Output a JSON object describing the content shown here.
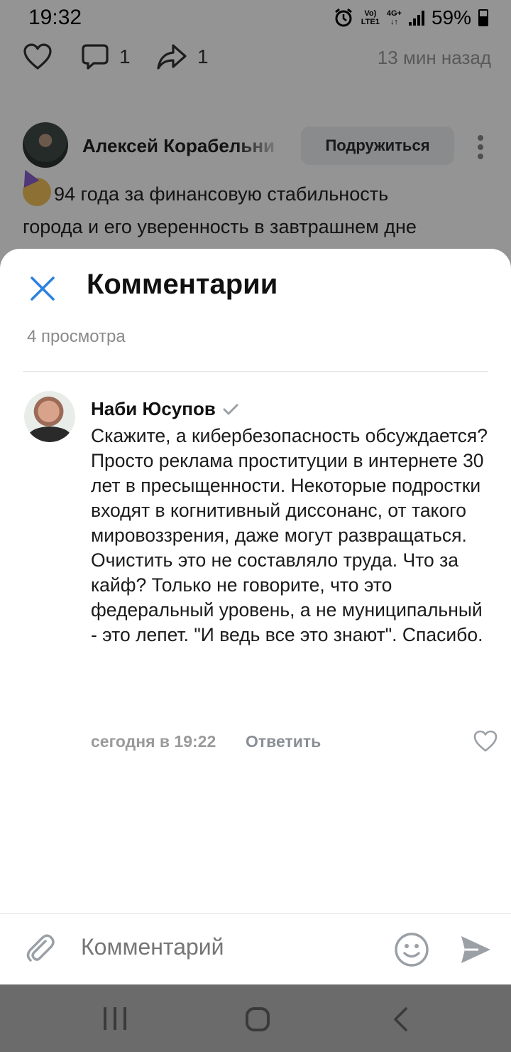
{
  "status_bar": {
    "time": "19:32",
    "network_top": "Vo)",
    "network_bottom": "LTE1",
    "network_type": "4G+",
    "battery": "59%"
  },
  "post": {
    "comments_count": "1",
    "shares_count": "1",
    "time_ago": "13 мин назад",
    "author_name": "Алексей Корабельни",
    "follow_label": "Подружиться",
    "text_line_1": "94 года за финансовую стабильность",
    "text_line_2": "города и его уверенность в завтрашнем дне"
  },
  "comments_sheet": {
    "title": "Комментарии",
    "views": "4 просмотра",
    "comment": {
      "author": "Наби Юсупов",
      "text": "Скажите, а кибербезопасность обсуждается? Просто реклама проституции в интернете 30 лет в пресыщенности. Некоторые подростки входят в когнитивный диссонанс, от такого мировоззрения, даже могут развращаться. Очистить это не составляло труда. Что за кайф? Только не говорите, что это федеральный уровень, а не муниципальный - это лепет. \"И ведь все это знают\". Спасибо.",
      "date": "сегодня в 19:22",
      "reply_label": "Ответить"
    },
    "composer": {
      "placeholder": "Комментарий"
    }
  },
  "icons": {
    "like": "heart-icon",
    "comment": "comment-bubble-icon",
    "share": "share-arrow-icon",
    "more": "more-vertical-icon",
    "close": "close-icon",
    "verified": "check-icon",
    "attach": "paperclip-icon",
    "emoji": "smiley-icon",
    "send": "send-icon"
  },
  "colors": {
    "accent": "#2d81e0",
    "muted": "#8a8f96",
    "overlay": "rgba(0,0,0,0.42)",
    "nav_bar": "#6b6b6b"
  }
}
